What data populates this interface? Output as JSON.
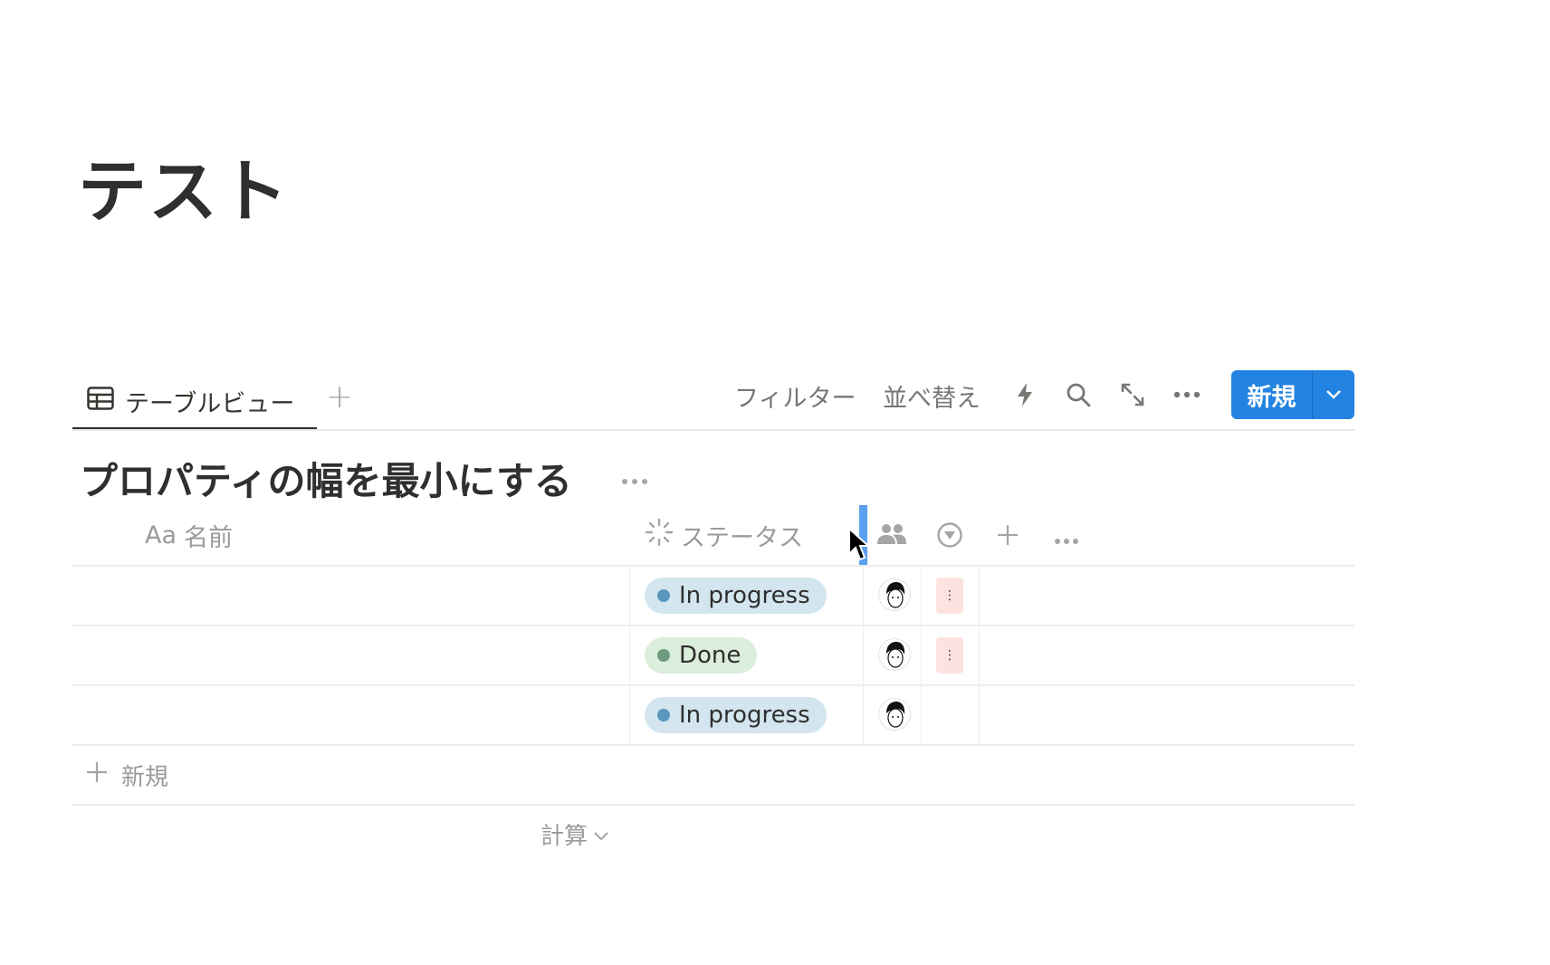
{
  "page": {
    "title": "テスト"
  },
  "view": {
    "tab_label": "テーブルビュー",
    "add_view": "+"
  },
  "toolbar": {
    "filter": "フィルター",
    "sort": "並べ替え",
    "new": "新規"
  },
  "database": {
    "title": "プロパティの幅を最小にする"
  },
  "columns": [
    {
      "icon": "Aa",
      "label": "名前"
    },
    {
      "label": "ステータス"
    }
  ],
  "rows": [
    {
      "status": "In progress",
      "status_color": "#d3e5ef",
      "dot": "#5b97bd"
    },
    {
      "status": "Done",
      "status_color": "#dbeddb",
      "dot": "#6c9b7d"
    },
    {
      "status": "In progress",
      "status_color": "#d3e5ef",
      "dot": "#5b97bd"
    }
  ],
  "footer": {
    "new_row": "新規",
    "calculate": "計算"
  },
  "accent": "#2383e2"
}
